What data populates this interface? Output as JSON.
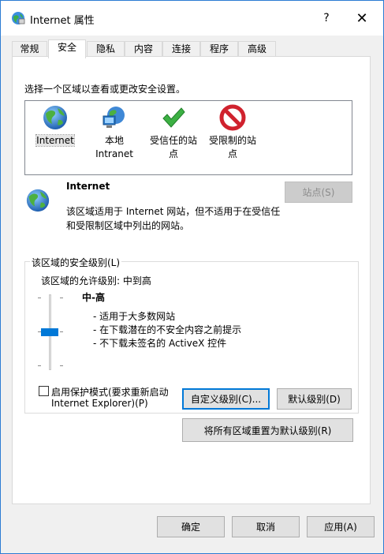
{
  "window": {
    "title": "Internet 属性",
    "help_glyph": "?",
    "close_glyph": "✕"
  },
  "tabs": [
    {
      "label": "常规"
    },
    {
      "label": "安全"
    },
    {
      "label": "隐私"
    },
    {
      "label": "内容"
    },
    {
      "label": "连接"
    },
    {
      "label": "程序"
    },
    {
      "label": "高级"
    }
  ],
  "active_tab": "安全",
  "security": {
    "instruction": "选择一个区域以查看或更改安全设置。",
    "zones": [
      {
        "label": "Internet",
        "icon": "globe-icon"
      },
      {
        "label": "本地\nIntranet",
        "icon": "intranet-icon"
      },
      {
        "label": "受信任的站\n点",
        "icon": "checkmark-icon"
      },
      {
        "label": "受限制的站\n点",
        "icon": "restricted-icon"
      }
    ],
    "selected_zone": {
      "name": "Internet",
      "description": "该区域适用于 Internet 网站，但不适用于在受信任\n和受限制区域中列出的网站。",
      "sites_button": "站点(S)"
    },
    "level_group": {
      "title": "该区域的安全级别(L)",
      "allowed_levels": "该区域的允许级别: 中到高",
      "level_name": "中-高",
      "bullets": [
        "- 适用于大多数网站",
        "- 在下载潜在的不安全内容之前提示",
        "- 不下载未签名的 ActiveX 控件"
      ],
      "protected_mode_label_line1": "启用保护模式(要求重新启动",
      "protected_mode_label_line2": "Internet Explorer)(P)",
      "protected_mode_checked": false,
      "custom_level_button": "自定义级别(C)...",
      "default_level_button": "默认级别(D)"
    },
    "reset_all_button": "将所有区域重置为默认级别(R)"
  },
  "footer": {
    "ok": "确定",
    "cancel": "取消",
    "apply": "应用(A)"
  },
  "colors": {
    "accent": "#0078d7",
    "restricted_red": "#d0222e",
    "trusted_green": "#3cb043"
  }
}
